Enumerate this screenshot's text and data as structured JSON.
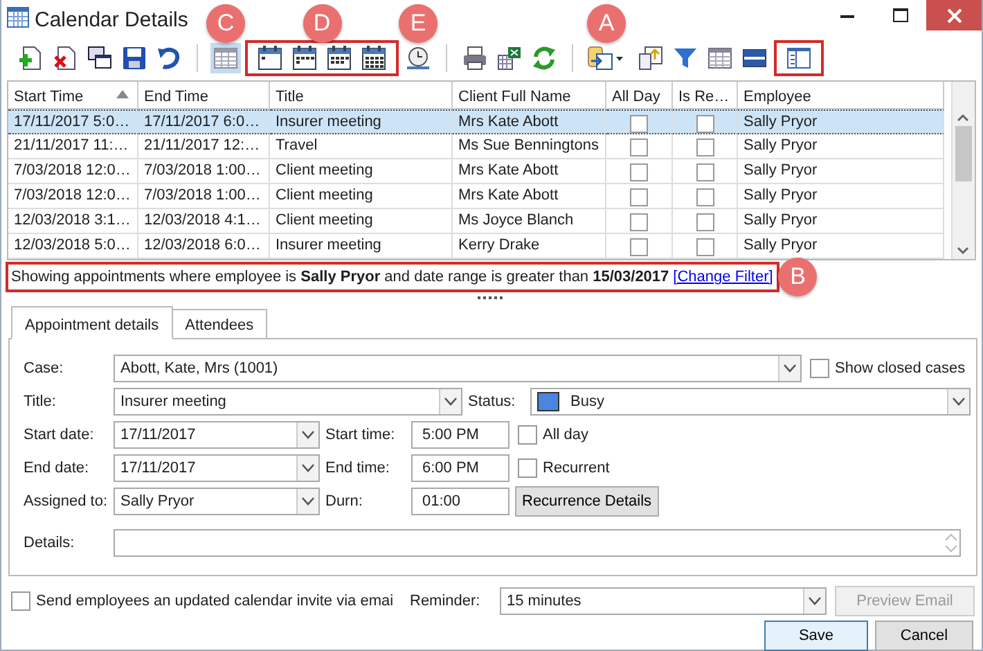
{
  "window": {
    "title": "Calendar Details"
  },
  "toolbar": {
    "sections": [
      {
        "outlined": false,
        "items": [
          {
            "kind": "add",
            "selected": false
          },
          {
            "kind": "delete",
            "selected": false
          },
          {
            "kind": "copy",
            "selected": false
          },
          {
            "kind": "save",
            "selected": false
          },
          {
            "kind": "undo",
            "selected": false
          }
        ]
      },
      {
        "outlined": false,
        "callout": "C",
        "items": [
          {
            "kind": "grid",
            "selected": true
          }
        ]
      },
      {
        "outlined": true,
        "callout": "D",
        "items": [
          {
            "kind": "day",
            "selected": false
          },
          {
            "kind": "workweek",
            "selected": false
          },
          {
            "kind": "week",
            "selected": false
          },
          {
            "kind": "month",
            "selected": false
          }
        ]
      },
      {
        "outlined": false,
        "callout": "E",
        "items": [
          {
            "kind": "timeline",
            "selected": false
          }
        ]
      },
      {
        "outlined": false,
        "items": [
          {
            "kind": "print",
            "selected": false
          },
          {
            "kind": "export",
            "selected": false
          },
          {
            "kind": "refresh",
            "selected": false
          }
        ]
      },
      {
        "outlined": false,
        "callout": "A",
        "items": [
          {
            "kind": "layout-menu",
            "selected": false
          }
        ]
      },
      {
        "outlined": false,
        "items": [
          {
            "kind": "import",
            "selected": false
          },
          {
            "kind": "filter",
            "selected": false
          },
          {
            "kind": "table",
            "selected": false
          },
          {
            "kind": "split",
            "selected": false
          }
        ]
      },
      {
        "outlined": true,
        "items": [
          {
            "kind": "panel",
            "selected": false
          }
        ]
      }
    ]
  },
  "grid": {
    "columns": [
      {
        "label": "Start Time",
        "sorted": true
      },
      {
        "label": "End Time",
        "sorted": false
      },
      {
        "label": "Title",
        "sorted": false
      },
      {
        "label": "Client Full Name",
        "sorted": false
      },
      {
        "label": "All Day",
        "sorted": false
      },
      {
        "label": "Is Re…",
        "sorted": false
      },
      {
        "label": "Employee",
        "sorted": false
      }
    ],
    "rows": [
      {
        "start": "17/11/2017 5:0…",
        "end": "17/11/2017 6:0…",
        "title": "Insurer meeting",
        "client": "Mrs Kate Abott",
        "all_day": false,
        "recurring": false,
        "employee": "Sally Pryor",
        "selected": true
      },
      {
        "start": "21/11/2017 11:…",
        "end": "21/11/2017 12:…",
        "title": "Travel",
        "client": "Ms Sue Benningtons",
        "all_day": false,
        "recurring": false,
        "employee": "Sally Pryor",
        "selected": false
      },
      {
        "start": "7/03/2018 12:0…",
        "end": "7/03/2018 1:00…",
        "title": "Client meeting",
        "client": "Mrs Kate Abott",
        "all_day": false,
        "recurring": false,
        "employee": "Sally Pryor",
        "selected": false
      },
      {
        "start": "7/03/2018 12:0…",
        "end": "7/03/2018 1:00…",
        "title": "Client meeting",
        "client": "Mrs Kate Abott",
        "all_day": false,
        "recurring": false,
        "employee": "Sally Pryor",
        "selected": false
      },
      {
        "start": "12/03/2018 3:1…",
        "end": "12/03/2018 4:1…",
        "title": "Client meeting",
        "client": "Ms Joyce Blanch",
        "all_day": false,
        "recurring": false,
        "employee": "Sally Pryor",
        "selected": false
      },
      {
        "start": "12/03/2018 5:0…",
        "end": "12/03/2018 6:0…",
        "title": "Insurer meeting",
        "client": "Kerry Drake",
        "all_day": false,
        "recurring": false,
        "employee": "Sally Pryor",
        "selected": false
      }
    ]
  },
  "filter": {
    "text": "Showing appointments where employee is **Sally Pryor** and date range is greater than **15/03/2017**",
    "link": "[Change Filter]",
    "outlined": true,
    "callout": "B"
  },
  "tabs": [
    {
      "label": "Appointment details",
      "selected": true
    },
    {
      "label": "Attendees",
      "selected": false
    }
  ],
  "form": {
    "case": {
      "label": "Case:",
      "value": "Abott, Kate, Mrs (1001)"
    },
    "show_closed": {
      "label": "Show closed cases",
      "checked": false
    },
    "title": {
      "label": "Title:",
      "value": "Insurer meeting"
    },
    "status": {
      "label": "Status:",
      "value": "Busy",
      "color": "#4a86e0"
    },
    "start_date": {
      "label": "Start date:",
      "value": "17/11/2017"
    },
    "start_time": {
      "label": "Start time:",
      "value": "5:00 PM"
    },
    "all_day": {
      "label": "All day",
      "checked": false
    },
    "end_date": {
      "label": "End date:",
      "value": "17/11/2017"
    },
    "end_time": {
      "label": "End time:",
      "value": "6:00 PM"
    },
    "recurrent": {
      "label": "Recurrent",
      "checked": false
    },
    "assigned_to": {
      "label": "Assigned to:",
      "value": "Sally Pryor"
    },
    "durn": {
      "label": "Durn:",
      "value": "01:00"
    },
    "recurrence_button": "Recurrence Details",
    "details": {
      "label": "Details:"
    }
  },
  "footer": {
    "send_invite": {
      "label": "Send employees an updated calendar invite via emai",
      "checked": false
    },
    "reminder": {
      "label": "Reminder:",
      "value": "15 minutes"
    },
    "preview_email": {
      "label": "Preview Email",
      "disabled": true
    },
    "buttons": [
      {
        "label": "Save",
        "default": true
      },
      {
        "label": "Cancel",
        "default": false
      }
    ]
  }
}
